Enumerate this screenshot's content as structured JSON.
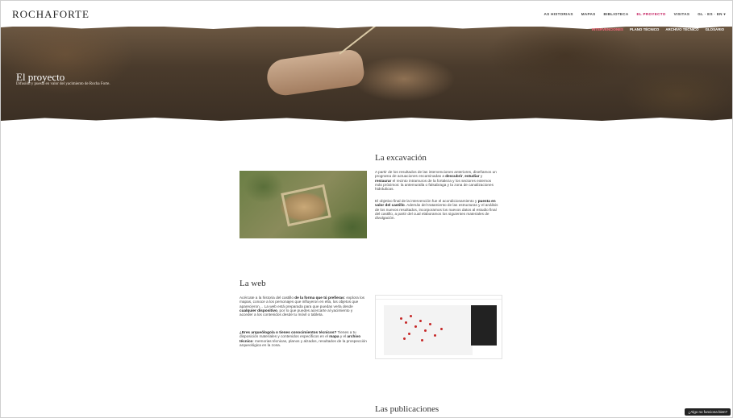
{
  "header": {
    "logo": "ROCHAFORTE",
    "nav": [
      "AS HISTORIAS",
      "MAPAS",
      "BIBLIOTECA",
      "EL PROYECTO",
      "VISITAS",
      "GL · ES · EN ▾"
    ],
    "active_nav": "EL PROYECTO",
    "subnav": [
      "INTERVENCIONES",
      "PLANO TÉCNICO",
      "ARCHIVO TÉCNICO",
      "GLOSARIO"
    ],
    "active_subnav": "INTERVENCIONES"
  },
  "hero": {
    "title": "El proyecto",
    "subtitle": "Difusión y puesta en valor del yacimiento de Rocha Forte."
  },
  "excavacion": {
    "title": "La excavación",
    "p1_a": "A partir de los resultados de las intervenciones anteriores, diseñamos un programa de actuaciones encaminadas a ",
    "p1_b1": "descubrir",
    "p1_c": ", ",
    "p1_b2": "estudiar",
    "p1_d": " y ",
    "p1_b3": "restaurar",
    "p1_e": " el recinto intramuros de la fortaleza y los sectores externos más próximos: la antemuralla o falsabraga y la zona de canalizaciones hidráulicas.",
    "p2_a": "El objetivo final de la intervención fue el acondicionamiento y ",
    "p2_b": "puesta en valor del castillo",
    "p2_c": ". Además del tratamiento de las estructuras y el análisis de los nuevos resultados, incorporamos los nuevos datos al estudio final del castillo, a partir del cual elaboramos los siguientes materiales de divulgación."
  },
  "web": {
    "title": "La web",
    "p1_a": "Acércate a la historia del castillo ",
    "p1_b": "de la forma que tú prefieras",
    "p1_c": ": explora los mapas, conoce a los personajes que influyeron en ella, los objetos que aparecieron… La web está preparada para que puedas verla desde ",
    "p1_d": "cualquier dispositivo",
    "p1_e": ", por lo que puedes acercarte al yacimiento y acceder a los contenidos desde tu móvil o tableta.",
    "p2_a": "¿Eres arqueólogo/a o tienes conocimientos técnicos?",
    "p2_b": " Tienes a tu disposición materiales y contenidos específicos en el ",
    "p2_c": "mapa",
    "p2_d": " y el ",
    "p2_e": "archivo técnico",
    "p2_f": ": memorias técnicas, planos y alzados, resultados de la prospección arqueológica en la zona."
  },
  "publicaciones": {
    "title": "Las publicaciones"
  },
  "help_button": "¿Algo no funciona bien?"
}
